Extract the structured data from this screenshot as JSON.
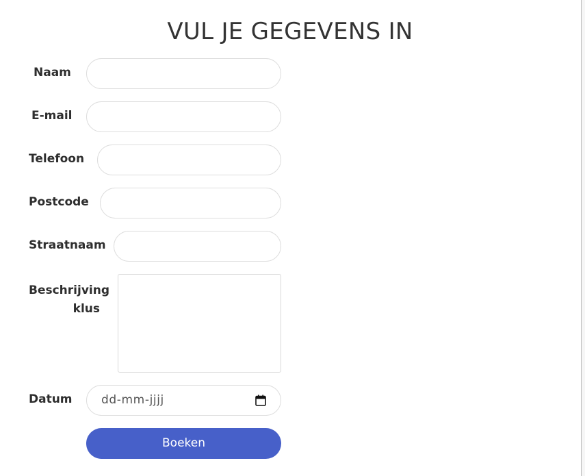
{
  "form": {
    "title": "VUL JE GEGEVENS IN",
    "fields": {
      "naam": {
        "label": "Naam",
        "value": ""
      },
      "email": {
        "label": "E-mail",
        "value": ""
      },
      "telefoon": {
        "label": "Telefoon",
        "value": ""
      },
      "postcode": {
        "label": "Postcode",
        "value": ""
      },
      "straatnaam": {
        "label": "Straatnaam",
        "value": ""
      },
      "beschrijving": {
        "label_line1": "Beschrijving",
        "label_line2": "klus",
        "value": ""
      },
      "datum": {
        "label": "Datum",
        "placeholder": "dd-mm-jjjj"
      }
    },
    "submit_label": "Boeken"
  },
  "colors": {
    "accent": "#4760c9",
    "text": "#333333",
    "field_border": "#dddddd"
  },
  "icons": {
    "date_picker": "calendar-icon"
  }
}
